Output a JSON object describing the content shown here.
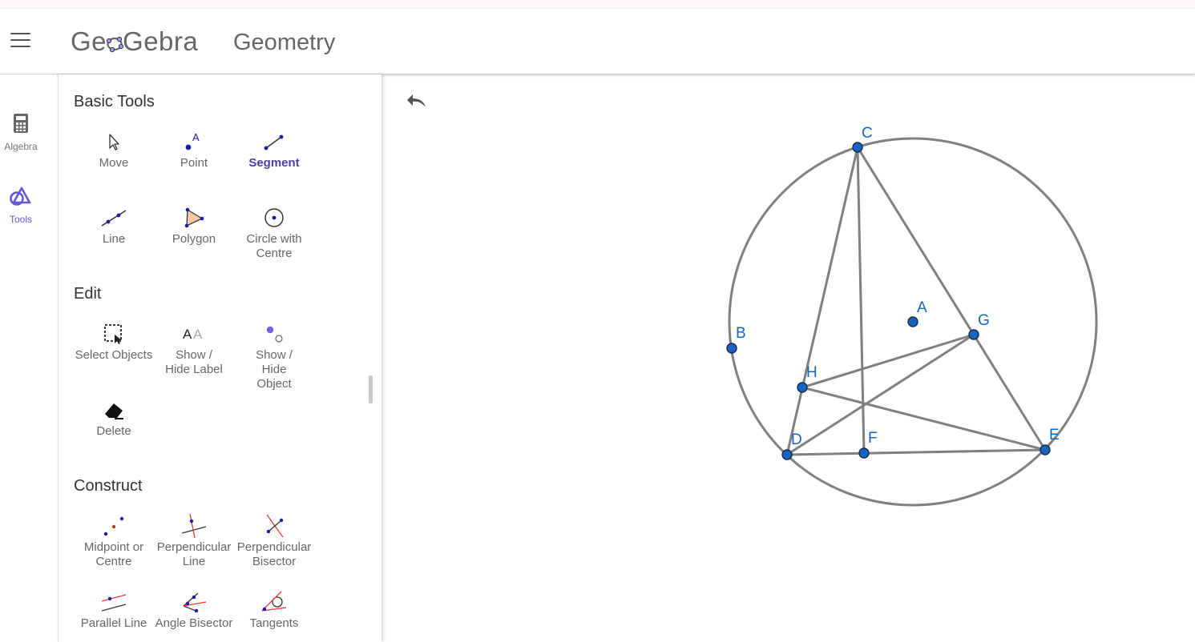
{
  "header": {
    "logo_text_left": "Ge",
    "logo_text_right": "Gebra",
    "app_title": "Geometry"
  },
  "siderail": {
    "items": [
      {
        "label": "Algebra",
        "icon": "calculator-icon",
        "active": false
      },
      {
        "label": "Tools",
        "icon": "tools-shapes-icon",
        "active": true
      }
    ]
  },
  "tools": {
    "sections": [
      {
        "title": "Basic Tools",
        "tools": [
          {
            "label": "Move",
            "icon": "move-arrow-icon"
          },
          {
            "label": "Point",
            "icon": "point-icon"
          },
          {
            "label": "Segment",
            "icon": "segment-icon",
            "selected": true
          },
          {
            "label": "Line",
            "icon": "line-icon"
          },
          {
            "label": "Polygon",
            "icon": "polygon-icon"
          },
          {
            "label": "Circle with Centre",
            "icon": "circle-centre-icon"
          }
        ]
      },
      {
        "title": "Edit",
        "tools": [
          {
            "label": "Select Objects",
            "icon": "select-objects-icon"
          },
          {
            "label": "Show / Hide Label",
            "icon": "show-hide-label-icon"
          },
          {
            "label": "Show / Hide Object",
            "icon": "show-hide-object-icon"
          },
          {
            "label": "Delete",
            "icon": "eraser-icon"
          }
        ]
      },
      {
        "title": "Construct",
        "tools": [
          {
            "label": "Midpoint or Centre",
            "icon": "midpoint-icon"
          },
          {
            "label": "Perpendicular Line",
            "icon": "perpendicular-line-icon"
          },
          {
            "label": "Perpendicular Bisector",
            "icon": "perpendicular-bisector-icon"
          },
          {
            "label": "Parallel Line",
            "icon": "parallel-line-icon"
          },
          {
            "label": "Angle Bisector",
            "icon": "angle-bisector-icon"
          },
          {
            "label": "Tangents",
            "icon": "tangents-icon"
          }
        ]
      }
    ],
    "show_hide_label_glyphs": "AA"
  },
  "graphics": {
    "undo_icon": "undo-icon",
    "point_labels": [
      "A",
      "B",
      "C",
      "D",
      "E",
      "F",
      "G",
      "H"
    ],
    "colors": {
      "point_fill": "#1565c0",
      "label": "#1565c0",
      "stroke": "#808080",
      "accent": "#6557d2"
    }
  }
}
